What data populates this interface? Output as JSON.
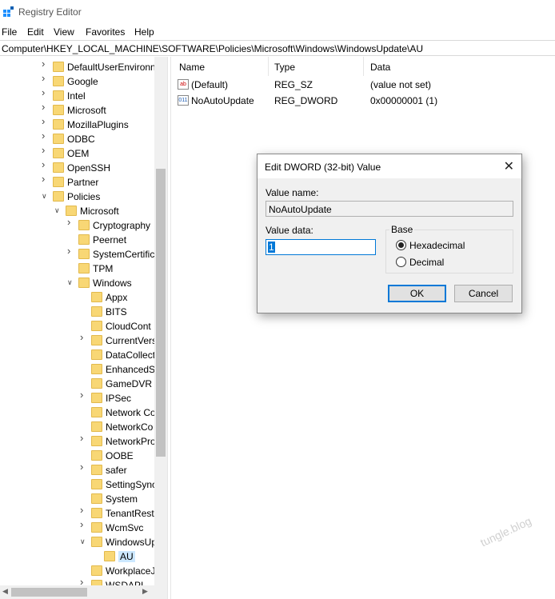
{
  "window": {
    "title": "Registry Editor"
  },
  "menu": [
    "File",
    "Edit",
    "View",
    "Favorites",
    "Help"
  ],
  "address": "Computer\\HKEY_LOCAL_MACHINE\\SOFTWARE\\Policies\\Microsoft\\Windows\\WindowsUpdate\\AU",
  "tree": [
    {
      "label": "DefaultUserEnvironn",
      "level": 1,
      "expander": "chevron-right-icon"
    },
    {
      "label": "Google",
      "level": 1,
      "expander": "chevron-right-icon"
    },
    {
      "label": "Intel",
      "level": 1,
      "expander": "chevron-right-icon"
    },
    {
      "label": "Microsoft",
      "level": 1,
      "expander": "chevron-right-icon"
    },
    {
      "label": "MozillaPlugins",
      "level": 1,
      "expander": "chevron-right-icon"
    },
    {
      "label": "ODBC",
      "level": 1,
      "expander": "chevron-right-icon"
    },
    {
      "label": "OEM",
      "level": 1,
      "expander": "chevron-right-icon"
    },
    {
      "label": "OpenSSH",
      "level": 1,
      "expander": "chevron-right-icon"
    },
    {
      "label": "Partner",
      "level": 1,
      "expander": "chevron-right-icon"
    },
    {
      "label": "Policies",
      "level": 1,
      "expander": "chevron-down-icon"
    },
    {
      "label": "Microsoft",
      "level": 2,
      "expander": "chevron-down-icon"
    },
    {
      "label": "Cryptography",
      "level": 3,
      "expander": "chevron-right-icon"
    },
    {
      "label": "Peernet",
      "level": 3,
      "expander": ""
    },
    {
      "label": "SystemCertific",
      "level": 3,
      "expander": "chevron-right-icon"
    },
    {
      "label": "TPM",
      "level": 3,
      "expander": ""
    },
    {
      "label": "Windows",
      "level": 3,
      "expander": "chevron-down-icon"
    },
    {
      "label": "Appx",
      "level": 4,
      "expander": ""
    },
    {
      "label": "BITS",
      "level": 4,
      "expander": ""
    },
    {
      "label": "CloudCont",
      "level": 4,
      "expander": ""
    },
    {
      "label": "CurrentVers",
      "level": 4,
      "expander": "chevron-right-icon"
    },
    {
      "label": "DataCollect",
      "level": 4,
      "expander": ""
    },
    {
      "label": "EnhancedS",
      "level": 4,
      "expander": ""
    },
    {
      "label": "GameDVR",
      "level": 4,
      "expander": ""
    },
    {
      "label": "IPSec",
      "level": 4,
      "expander": "chevron-right-icon"
    },
    {
      "label": "Network Co",
      "level": 4,
      "expander": ""
    },
    {
      "label": "NetworkCo",
      "level": 4,
      "expander": ""
    },
    {
      "label": "NetworkPro",
      "level": 4,
      "expander": "chevron-right-icon"
    },
    {
      "label": "OOBE",
      "level": 4,
      "expander": ""
    },
    {
      "label": "safer",
      "level": 4,
      "expander": "chevron-right-icon"
    },
    {
      "label": "SettingSync",
      "level": 4,
      "expander": ""
    },
    {
      "label": "System",
      "level": 4,
      "expander": ""
    },
    {
      "label": "TenantRestr",
      "level": 4,
      "expander": "chevron-right-icon"
    },
    {
      "label": "WcmSvc",
      "level": 4,
      "expander": "chevron-right-icon"
    },
    {
      "label": "WindowsUp",
      "level": 4,
      "expander": "chevron-down-icon"
    },
    {
      "label": "AU",
      "level": 5,
      "expander": "",
      "selected": true
    },
    {
      "label": "WorkplaceJ",
      "level": 4,
      "expander": ""
    },
    {
      "label": "WSDAPI",
      "level": 4,
      "expander": "chevron-right-icon"
    }
  ],
  "list": {
    "columns": [
      "Name",
      "Type",
      "Data"
    ],
    "rows": [
      {
        "icon": "string-value-icon",
        "icon_text": "ab",
        "name": "(Default)",
        "type": "REG_SZ",
        "data": "(value not set)"
      },
      {
        "icon": "dword-value-icon",
        "icon_text": "011",
        "name": "NoAutoUpdate",
        "type": "REG_DWORD",
        "data": "0x00000001 (1)"
      }
    ]
  },
  "dialog": {
    "title": "Edit DWORD (32-bit) Value",
    "value_name_label": "Value name:",
    "value_name": "NoAutoUpdate",
    "value_data_label": "Value data:",
    "value_data": "1",
    "base_label": "Base",
    "radio_hex": "Hexadecimal",
    "radio_dec": "Decimal",
    "selected_base": "Hexadecimal",
    "ok": "OK",
    "cancel": "Cancel"
  },
  "watermark": "tungle.blog"
}
